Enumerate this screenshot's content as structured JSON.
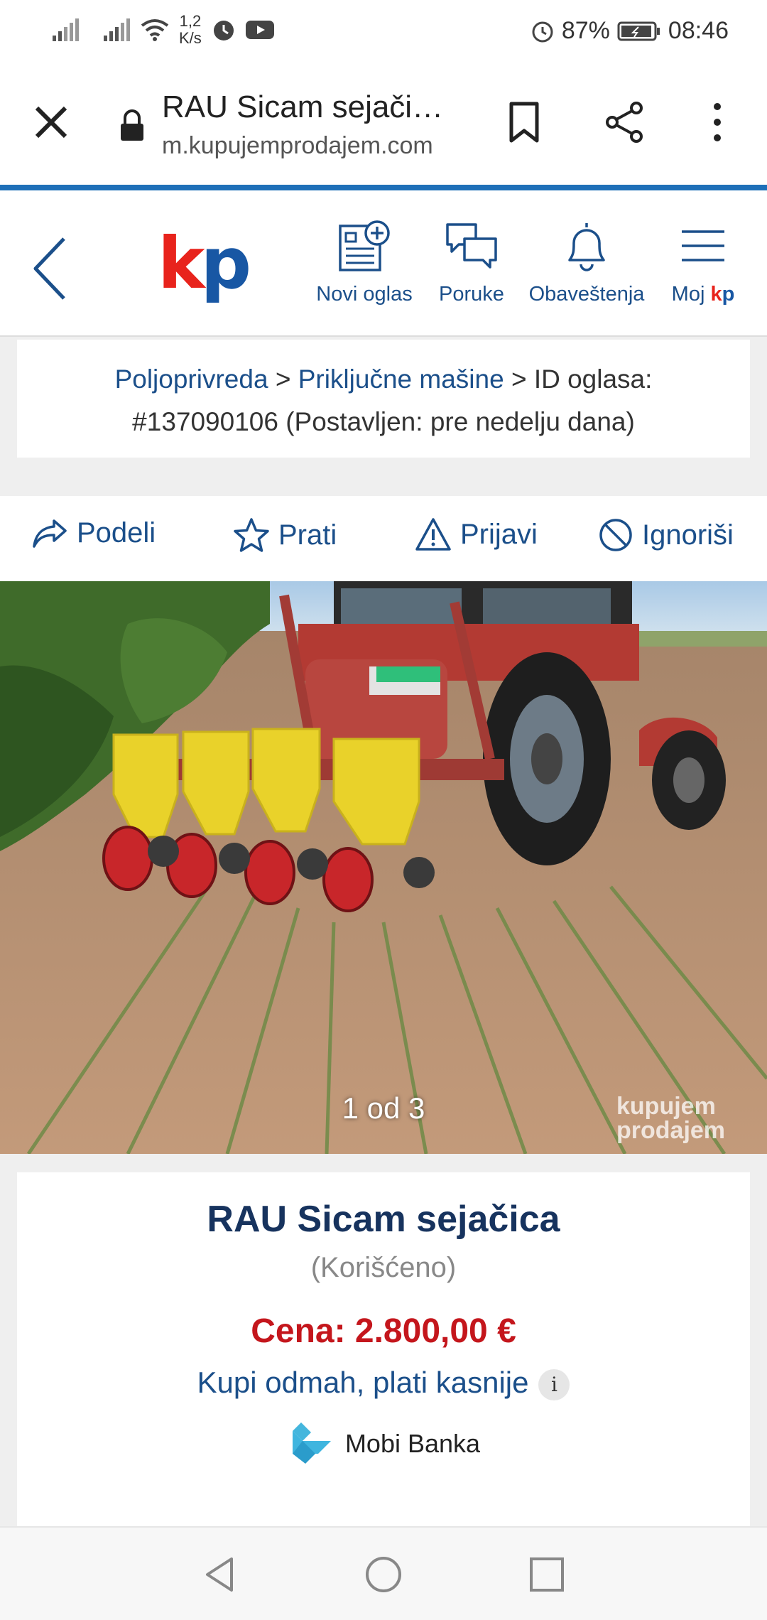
{
  "status_bar": {
    "speed_value": "1,2",
    "speed_unit": "K/s",
    "battery": "87%",
    "time": "08:46",
    "icons": [
      "signal-icon",
      "signal-icon",
      "wifi-icon",
      "alarm-icon",
      "youtube-icon",
      "alarm-icon",
      "battery-icon"
    ]
  },
  "browser": {
    "title": "RAU Sicam sejači…",
    "url": "m.kupujemprodajem.com"
  },
  "site_nav": {
    "logo_k": "k",
    "logo_p": "p",
    "items": [
      {
        "label": "Novi oglas",
        "icon": "new-ad-icon"
      },
      {
        "label": "Poruke",
        "icon": "messages-icon"
      },
      {
        "label": "Obaveštenja",
        "icon": "bell-icon"
      },
      {
        "label": "Moj ",
        "label_kp_k": "k",
        "label_kp_p": "p",
        "icon": "menu-icon"
      }
    ]
  },
  "breadcrumb": {
    "cat1": "Poljoprivreda",
    "sep": ">",
    "cat2": "Priključne mašine",
    "id_label": "ID oglasa:",
    "id_value": "#137090106 (Postavljen: pre nedelju dana)"
  },
  "actions": [
    {
      "label": "Podeli",
      "icon": "share-arrow-icon"
    },
    {
      "label": "Prati",
      "icon": "star-icon"
    },
    {
      "label": "Prijavi",
      "icon": "warning-icon"
    },
    {
      "label": "Ignoriši",
      "icon": "block-icon"
    }
  ],
  "photo": {
    "counter": "1 od 3",
    "watermark_line1": "kupujem",
    "watermark_line2": "prodajem"
  },
  "product": {
    "name": "RAU Sicam sejačica",
    "condition": "(Korišćeno)",
    "price": "Cena: 2.800,00 €",
    "pay_later": "Kupi odmah, plati kasnije",
    "info_badge": "i",
    "bank": "Mobi Banka"
  },
  "colors": {
    "brand_blue": "#1b4f8a",
    "logo_red": "#e8231c",
    "price_red": "#c4161c",
    "accent_line": "#1e6fb8"
  }
}
